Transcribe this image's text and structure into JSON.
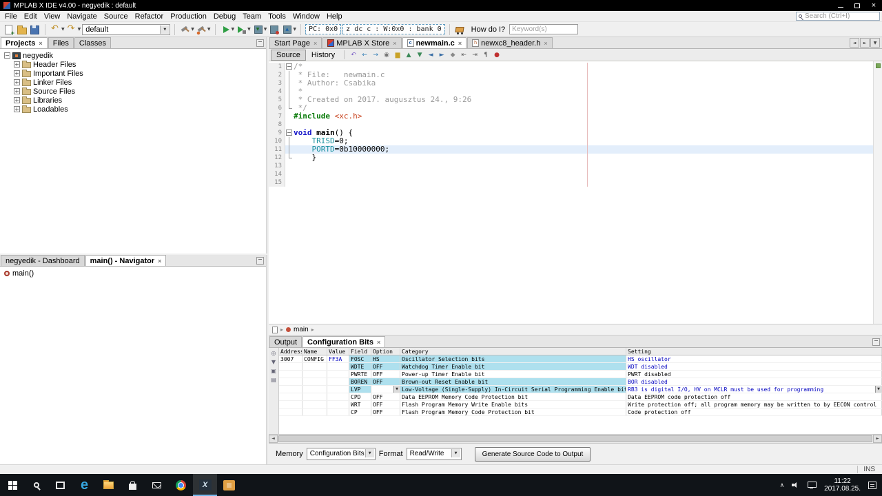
{
  "window": {
    "title": "MPLAB X IDE v4.00 - negyedik : default"
  },
  "menu_bar": {
    "items": [
      "File",
      "Edit",
      "View",
      "Navigate",
      "Source",
      "Refactor",
      "Production",
      "Debug",
      "Team",
      "Tools",
      "Window",
      "Help"
    ],
    "search_placeholder": "Search (Ctrl+I)"
  },
  "toolbar": {
    "config_select_value": "default",
    "pc_field": "PC: 0x0",
    "status_field": "z dc c : W:0x0 : bank 0",
    "how_do_i_label": "How do I?",
    "how_do_i_placeholder": "Keyword(s)",
    "items": [
      {
        "type": "icon",
        "name": "new-file"
      },
      {
        "type": "icon",
        "name": "open-project"
      },
      {
        "type": "icon",
        "name": "save-all"
      },
      {
        "type": "sep"
      },
      {
        "type": "icon",
        "name": "undo",
        "dd": true
      },
      {
        "type": "icon",
        "name": "redo",
        "dd": true
      },
      {
        "type": "combo",
        "name": "configuration-select",
        "bind": "toolbar.config_select_value",
        "width": 128
      },
      {
        "type": "sep"
      },
      {
        "type": "icon",
        "name": "build-project",
        "dd": true
      },
      {
        "type": "icon",
        "name": "clean-build-project",
        "dd": true
      },
      {
        "type": "sep"
      },
      {
        "type": "icon",
        "name": "run-project",
        "dd": true
      },
      {
        "type": "icon",
        "name": "debug-project",
        "dd": true
      },
      {
        "type": "icon",
        "name": "make-program-device",
        "dd": true
      },
      {
        "type": "icon",
        "name": "hold-in-reset"
      },
      {
        "type": "icon",
        "name": "read-device-memory",
        "dd": true
      },
      {
        "type": "sep"
      },
      {
        "type": "box",
        "name": "pc-field",
        "bind": "toolbar.pc_field"
      },
      {
        "type": "box",
        "name": "status-flags-field",
        "bind": "toolbar.status_field"
      },
      {
        "type": "sep"
      },
      {
        "type": "icon",
        "name": "store-cart"
      },
      {
        "type": "label",
        "name": "how-do-i-label",
        "bind": "toolbar.how_do_i_label"
      },
      {
        "type": "input",
        "name": "how-do-i-input",
        "placeholder_bind": "toolbar.how_do_i_placeholder",
        "width": 100
      }
    ]
  },
  "projects_panel": {
    "tabs": [
      {
        "label": "Projects",
        "active": true,
        "closable": true
      },
      {
        "label": "Files"
      },
      {
        "label": "Classes"
      }
    ],
    "root": "negyedik",
    "items": [
      "Header Files",
      "Important Files",
      "Linker Files",
      "Source Files",
      "Libraries",
      "Loadables"
    ]
  },
  "navigator_panel": {
    "tabs": [
      {
        "label": "negyedik - Dashboard"
      },
      {
        "label": "main() - Navigator",
        "active": true,
        "closable": true
      }
    ],
    "items": [
      "main()"
    ]
  },
  "editor": {
    "tabs": [
      {
        "label": "Start Page",
        "closable": true
      },
      {
        "label": "MPLAB X Store",
        "icon": "store",
        "closable": true
      },
      {
        "label": "newmain.c",
        "icon": "c-file",
        "letter": "c",
        "active": true,
        "closable": true
      },
      {
        "label": "newxc8_header.h",
        "icon": "h-file",
        "letter": "h",
        "closable": true
      }
    ],
    "views": [
      "Source",
      "History"
    ],
    "toolbar_icons": [
      {
        "name": "last-edit-icon",
        "glyph": "↶",
        "color": "#7b5ec7"
      },
      {
        "name": "back-icon",
        "glyph": "←",
        "color": "#2e7bb5"
      },
      {
        "name": "forward-icon",
        "glyph": "→",
        "color": "#2e7bb5"
      },
      {
        "name": "find-selection-icon",
        "glyph": "◉",
        "color": "#777777"
      },
      {
        "name": "highlight-icon",
        "glyph": "▆",
        "color": "#c9a227"
      },
      {
        "name": "previous-occurrence-icon",
        "glyph": "▲",
        "color": "#3e8a5a"
      },
      {
        "name": "next-occurrence-icon",
        "glyph": "▼",
        "color": "#3e8a5a"
      },
      {
        "name": "previous-bookmark-icon",
        "glyph": "◄",
        "color": "#3a6ea5"
      },
      {
        "name": "next-bookmark-icon",
        "glyph": "►",
        "color": "#3a6ea5"
      },
      {
        "name": "toggle-bookmark-icon",
        "glyph": "◆",
        "color": "#8a8a8a"
      },
      {
        "name": "shift-left-icon",
        "glyph": "⇤",
        "color": "#666666"
      },
      {
        "name": "shift-right-icon",
        "glyph": "⇥",
        "color": "#666666"
      },
      {
        "name": "comment-icon",
        "glyph": "¶",
        "color": "#666666"
      },
      {
        "name": "record-macro-icon",
        "glyph": "●",
        "color": "#c03030"
      }
    ],
    "breadcrumb": "main",
    "code": [
      {
        "n": 1,
        "fold": "start",
        "tokens": [
          {
            "t": "/*",
            "c": "cm"
          }
        ]
      },
      {
        "n": 2,
        "fold": "mid",
        "tokens": [
          {
            "t": " * File:   newmain.c",
            "c": "cm"
          }
        ]
      },
      {
        "n": 3,
        "fold": "mid",
        "tokens": [
          {
            "t": " * Author: Csabika",
            "c": "cm"
          }
        ]
      },
      {
        "n": 4,
        "fold": "mid",
        "tokens": [
          {
            "t": " *",
            "c": "cm"
          }
        ]
      },
      {
        "n": 5,
        "fold": "mid",
        "tokens": [
          {
            "t": " * Created on 2017. augusztus 24., 9:26",
            "c": "cm"
          }
        ]
      },
      {
        "n": 6,
        "fold": "end",
        "tokens": [
          {
            "t": " */",
            "c": "cm"
          }
        ]
      },
      {
        "n": 7,
        "tokens": [
          {
            "t": "#include ",
            "c": "dir"
          },
          {
            "t": "<xc.h>",
            "c": "inc"
          }
        ]
      },
      {
        "n": 8,
        "tokens": []
      },
      {
        "n": 9,
        "fold": "start",
        "tokens": [
          {
            "t": "void ",
            "c": "kw"
          },
          {
            "t": "main",
            "c": "fn"
          },
          {
            "t": "() {",
            "c": "pl"
          }
        ]
      },
      {
        "n": 10,
        "fold": "mid",
        "tokens": [
          {
            "t": "    ",
            "c": "pl"
          },
          {
            "t": "TRISD",
            "c": "fld"
          },
          {
            "t": "=0;",
            "c": "pl"
          }
        ]
      },
      {
        "n": 11,
        "fold": "mid",
        "current": true,
        "tokens": [
          {
            "t": "    ",
            "c": "pl"
          },
          {
            "t": "PORTD",
            "c": "fld"
          },
          {
            "t": "=0b10000000;",
            "c": "pl"
          }
        ]
      },
      {
        "n": 12,
        "fold": "end",
        "tokens": [
          {
            "t": "    }",
            "c": "pl"
          }
        ]
      },
      {
        "n": 13,
        "tokens": []
      },
      {
        "n": 14,
        "tokens": []
      },
      {
        "n": 15,
        "tokens": []
      }
    ]
  },
  "bottom_panel": {
    "tabs": [
      {
        "label": "Output"
      },
      {
        "label": "Configuration Bits",
        "active": true,
        "closable": true
      }
    ],
    "side_icons": [
      {
        "name": "search-output-icon",
        "glyph": "◎"
      },
      {
        "name": "filter-icon",
        "glyph": "▼"
      },
      {
        "name": "pin-icon",
        "glyph": "▣"
      },
      {
        "name": "clipboard-icon",
        "glyph": "▤"
      }
    ],
    "table": {
      "headers": [
        "Address",
        "Name",
        "Value",
        "Field",
        "Option",
        "Category",
        "Setting"
      ],
      "rows": [
        {
          "address": "3007",
          "name": "CONFIG",
          "value": "FF3A",
          "field": "FOSC",
          "option": "HS",
          "category": "Oscillator Selection bits",
          "setting": "HS oscillator",
          "hl": true,
          "chg": true
        },
        {
          "address": "",
          "name": "",
          "value": "",
          "field": "WDTE",
          "option": "OFF",
          "category": "Watchdog Timer Enable bit",
          "setting": "WDT disabled",
          "hl": true,
          "chg": true
        },
        {
          "address": "",
          "name": "",
          "value": "",
          "field": "PWRTE",
          "option": "OFF",
          "category": "Power-up Timer Enable bit",
          "setting": "PWRT disabled",
          "hl": false,
          "chg": false
        },
        {
          "address": "",
          "name": "",
          "value": "",
          "field": "BOREN",
          "option": "OFF",
          "category": "Brown-out Reset Enable bit",
          "setting": "BOR disabled",
          "hl": true,
          "chg": true
        },
        {
          "address": "",
          "name": "",
          "value": "",
          "field": "LVP",
          "option": "",
          "category": "Low-Voltage (Single-Supply) In-Circuit Serial Programming Enable bit",
          "setting": "RB3 is digital I/O, HV on MCLR must be used for programming",
          "hl": true,
          "chg": true,
          "editing": true
        },
        {
          "address": "",
          "name": "",
          "value": "",
          "field": "CPD",
          "option": "OFF",
          "category": "Data EEPROM Memory Code Protection bit",
          "setting": "Data EEPROM code protection off",
          "hl": false,
          "chg": false
        },
        {
          "address": "",
          "name": "",
          "value": "",
          "field": "WRT",
          "option": "OFF",
          "category": "Flash Program Memory Write Enable bits",
          "setting": "Write protection off; all program memory may be written to by EECON control",
          "hl": false,
          "chg": false
        },
        {
          "address": "",
          "name": "",
          "value": "",
          "field": "CP",
          "option": "OFF",
          "category": "Flash Program Memory Code Protection bit",
          "setting": "Code protection off",
          "hl": false,
          "chg": false
        }
      ]
    },
    "memory_label": "Memory",
    "memory_value": "Configuration Bits",
    "format_label": "Format",
    "format_value": "Read/Write",
    "generate_button": "Generate Source Code to Output"
  },
  "status_bar": {
    "insert_mode": "INS"
  },
  "taskbar": {
    "apps": [
      {
        "name": "start"
      },
      {
        "name": "search"
      },
      {
        "name": "task-view"
      },
      {
        "name": "edge"
      },
      {
        "name": "file-explorer"
      },
      {
        "name": "store"
      },
      {
        "name": "mail"
      },
      {
        "name": "chrome"
      },
      {
        "name": "mplab-x",
        "active": true
      },
      {
        "name": "mplab-ipe"
      }
    ],
    "clock": {
      "time": "11:22",
      "date": "2017.08.25."
    }
  },
  "colors": {
    "config_row_highlight": "#aee0ee",
    "changed_setting_text": "#0000c0",
    "taskbar_active_underline": "#76b9ed",
    "margin_guide": "#e7bcbc",
    "current_line_highlight": "#e3eefb"
  }
}
